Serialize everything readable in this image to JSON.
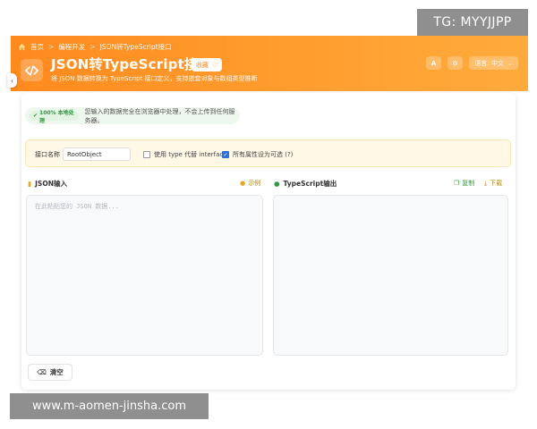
{
  "overlay": {
    "corner_tag": "TG: MYYJJPP",
    "watermark": "www.m-aomen-jinsha.com"
  },
  "header": {
    "breadcrumb": [
      "首页",
      "编程开发",
      "JSON转TypeScript接口"
    ],
    "title": "JSON转TypeScript接口",
    "favorite_label": "收藏",
    "subtitle": "将 JSON 数据转换为 TypeScript 接口定义，支持嵌套对象与数组类型推断",
    "font_button_label": "A",
    "language_label": "语言: 中文",
    "colors": {
      "header_start": "#ff8a1e",
      "header_end": "#ffab3c"
    }
  },
  "notice": {
    "badge": "100% 本地处理",
    "text": "您输入的数据完全在浏览器中处理，不会上传到任何服务器。"
  },
  "options": {
    "interface_name_label": "接口名称",
    "interface_name_value": "RootObject",
    "use_type_label": "使用 type 代替 interface",
    "use_type_checked": false,
    "optional_label": "所有属性设为可选 (?)",
    "optional_checked": true
  },
  "json_panel": {
    "title": "JSON输入",
    "example_label": "示例",
    "placeholder": "在此粘贴您的 JSON 数据..."
  },
  "ts_panel": {
    "title": "TypeScript输出",
    "copy_label": "复制",
    "download_label": "下载",
    "output": ""
  },
  "actions": {
    "clear_label": "清空"
  }
}
